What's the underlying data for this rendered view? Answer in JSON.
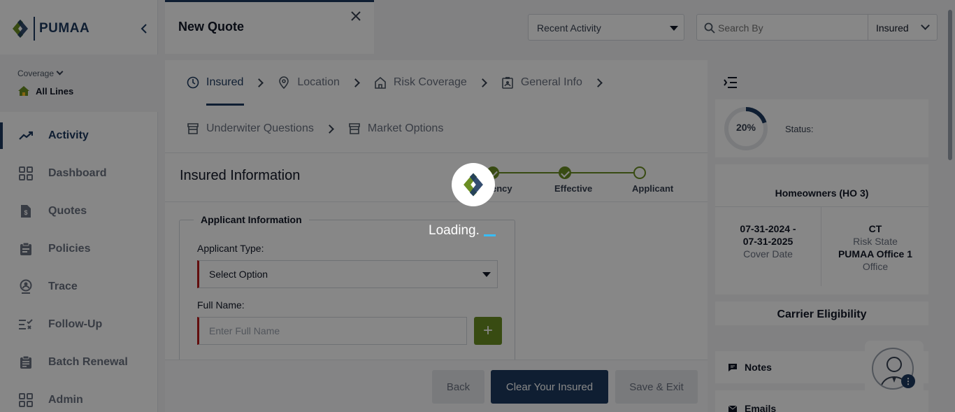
{
  "app": {
    "brand": "PUMAA"
  },
  "sidebar": {
    "coverage_label": "Coverage",
    "coverage_value": "All Lines",
    "items": [
      {
        "label": "Activity",
        "icon": "trend-icon",
        "active": true
      },
      {
        "label": "Dashboard",
        "icon": "grid-icon"
      },
      {
        "label": "Quotes",
        "icon": "quote-doc-icon"
      },
      {
        "label": "Policies",
        "icon": "clipboard-icon"
      },
      {
        "label": "Trace",
        "icon": "location-person-icon"
      },
      {
        "label": "Follow-Up",
        "icon": "checklist-icon"
      },
      {
        "label": "Batch Renewal",
        "icon": "clipboard-list-icon"
      },
      {
        "label": "Admin",
        "icon": "grid-icon"
      }
    ]
  },
  "header": {
    "tab_title": "New Quote",
    "recent_activity": "Recent Activity",
    "search_placeholder": "Search By",
    "search_type": "Insured"
  },
  "steps": {
    "row1": [
      "Insured",
      "Location",
      "Risk Coverage",
      "General Info"
    ],
    "row2": [
      "Underwiter Questions",
      "Market Options"
    ]
  },
  "section": {
    "title": "Insured Information",
    "progress": [
      "ency",
      "Effective",
      "Applicant"
    ]
  },
  "form": {
    "legend": "Applicant Information",
    "applicant_type_label": "Applicant Type:",
    "applicant_type_value": "Select Option",
    "full_name_label": "Full Name:",
    "full_name_placeholder": "Enter Full Name"
  },
  "footer": {
    "back": "Back",
    "clear": "Clear Your Insured",
    "save_exit": "Save & Exit"
  },
  "right_panel": {
    "progress_percent": "20%",
    "progress_value": 0.2,
    "status_label": "Status:",
    "plan": "Homeowners (HO 3)",
    "cover_date_from": "07-31-2024 -",
    "cover_date_to": "07-31-2025",
    "cover_date_label": "Cover Date",
    "risk_state": "CT",
    "risk_state_label": "Risk State",
    "office": "PUMAA Office 1",
    "office_label": "Office",
    "carrier_title": "Carrier Eligibility",
    "notes": "Notes",
    "emails": "Emails"
  },
  "overlay": {
    "loading_text": "Loading."
  },
  "colors": {
    "brand_navy": "#1e3a5f",
    "accent_green": "#6b8e23",
    "required_red": "#b91c1c"
  }
}
